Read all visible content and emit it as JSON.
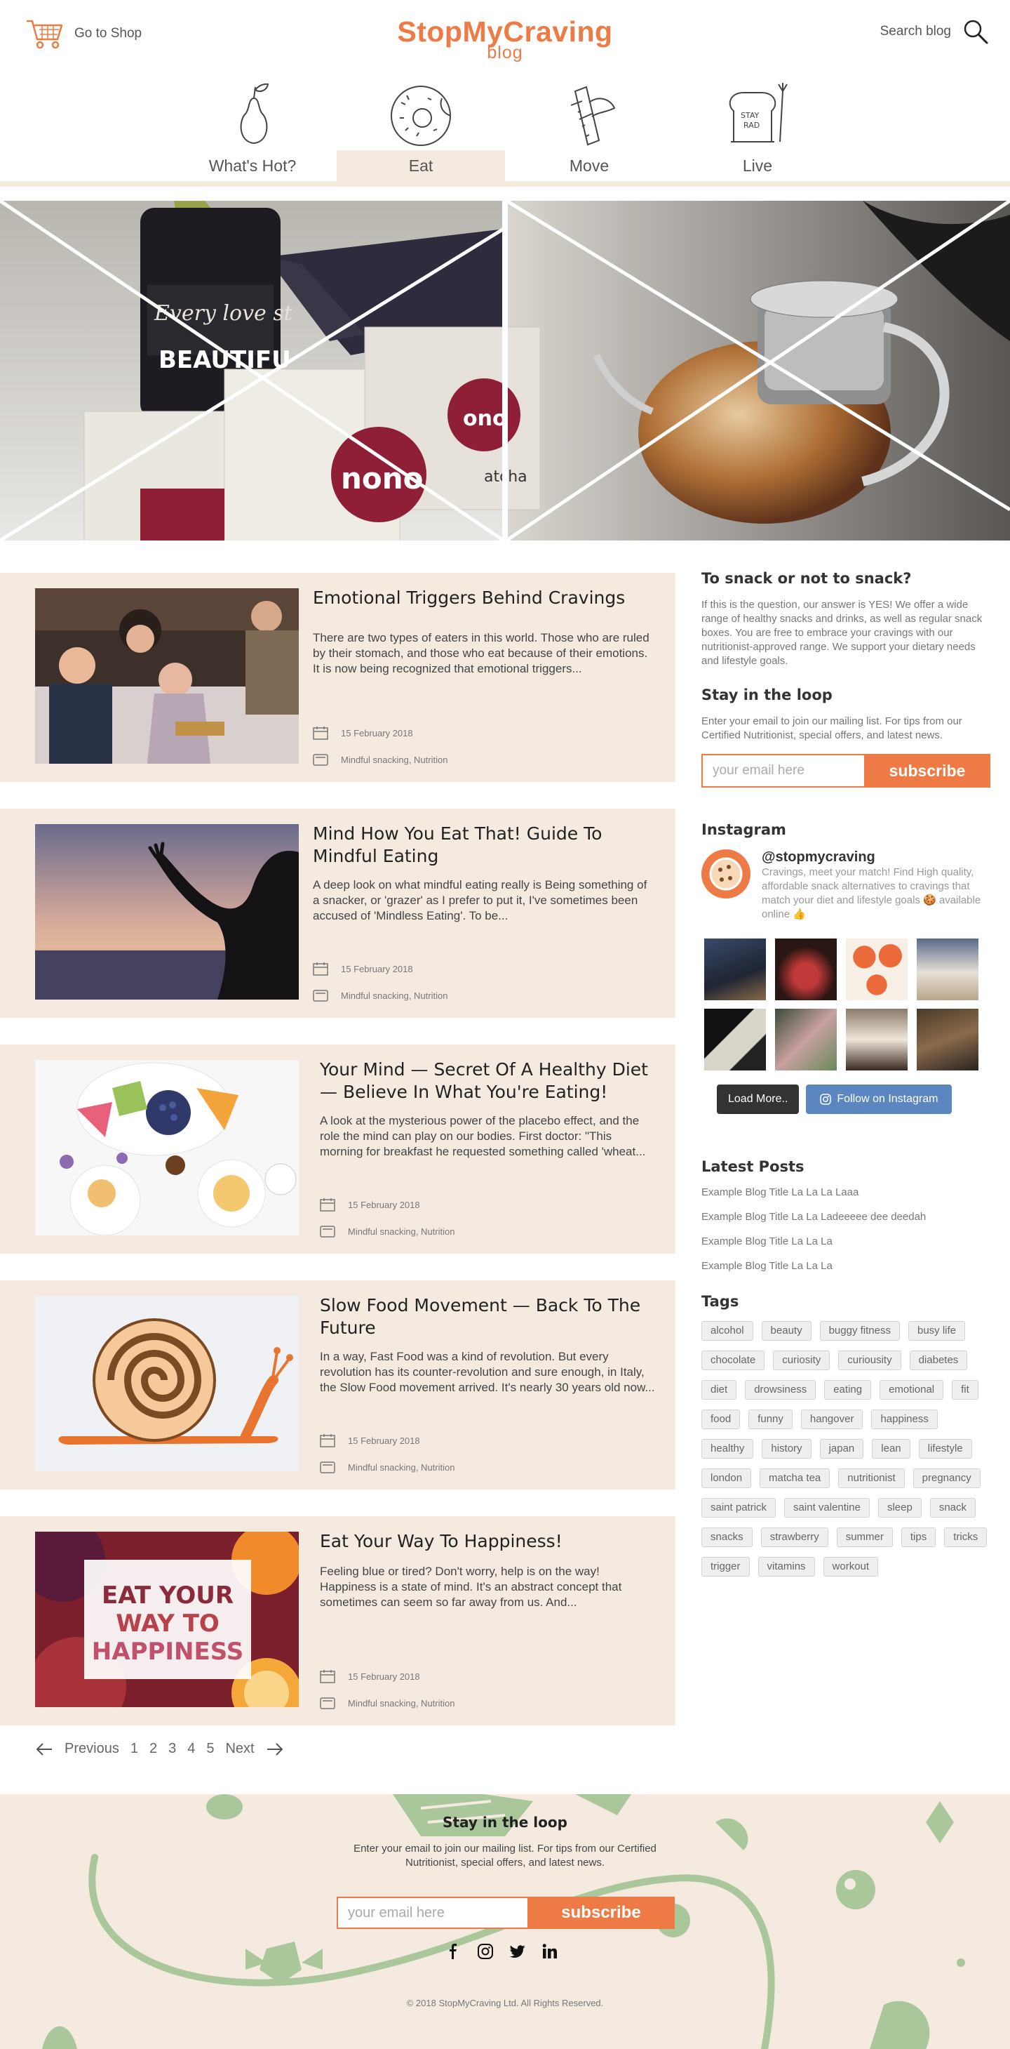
{
  "header": {
    "shop_label": "Go to Shop",
    "logo_main": "StopMyCraving",
    "logo_sub": "blog",
    "search_label": "Search blog"
  },
  "nav": {
    "items": [
      {
        "label": "What's Hot?",
        "icon": "pear-icon"
      },
      {
        "label": "Eat",
        "icon": "donut-icon",
        "active": true
      },
      {
        "label": "Move",
        "icon": "snack-bar-icon"
      },
      {
        "label": "Live",
        "icon": "toast-icon"
      }
    ]
  },
  "posts": [
    {
      "title": "Emotional Triggers Behind Cravings",
      "excerpt": "There are two types of eaters in this world. Those who are ruled by their stomach, and those who eat because of their emotions. It is now being recognized that emotional triggers...",
      "date": "15 February 2018",
      "categories": "Mindful snacking, Nutrition"
    },
    {
      "title": "Mind How You Eat That! Guide To Mindful Eating",
      "excerpt": "A deep look on what mindful eating really is   Being something of a snacker, or 'grazer' as I prefer to put it, I've sometimes been accused of 'Mindless Eating'. To be...",
      "date": "15 February 2018",
      "categories": "Mindful snacking, Nutrition"
    },
    {
      "title": "Your Mind — Secret Of A Healthy Diet — Believe In What You're Eating!",
      "excerpt": " A look at the mysterious power of the placebo effect, and the role the mind can play on our bodies.   First doctor: \"This morning for breakfast he requested something called 'wheat...",
      "date": "15 February 2018",
      "categories": "Mindful snacking, Nutrition"
    },
    {
      "title": "Slow Food Movement — Back To The Future",
      "excerpt": "In a way, Fast Food was a kind of revolution. But every revolution has its counter-revolution and sure enough, in Italy, the Slow Food movement arrived. It's nearly 30 years old now...",
      "date": "15 February 2018",
      "categories": "Mindful snacking, Nutrition"
    },
    {
      "title": "Eat Your Way To Happiness!",
      "excerpt": "Feeling blue or tired? Don't worry, help is on the way! Happiness is a state of mind. It's an abstract concept that sometimes can seem so far away from us. And...",
      "date": "15 February 2018",
      "categories": "Mindful snacking, Nutrition",
      "thumb_text": [
        "EAT YOUR",
        "WAY TO",
        "HAPPINESS"
      ]
    }
  ],
  "pager": {
    "prev": "Previous",
    "pages": [
      "1",
      "2",
      "3",
      "4",
      "5"
    ],
    "next": "Next"
  },
  "sidebar": {
    "snack_title": "To snack or not to snack?",
    "snack_text": "If this is the question, our answer is YES! We offer a wide range of healthy snacks and drinks, as well as regular snack boxes. You are free to embrace your cravings with our nutritionist-approved range. We support your dietary needs and lifestyle goals.",
    "loop_title": "Stay in the loop",
    "loop_text": "Enter your email to join our mailing list. For tips from our Certified Nutritionist, special offers, and latest news.",
    "email_placeholder": "your email here",
    "subscribe": "subscribe",
    "insta_title": "Instagram",
    "insta_handle": "@stopmycraving",
    "insta_bio": "Cravings, meet your match! Find High quality, affordable snack alternatives to cravings that match your diet and lifestyle goals 🍪 available online 👍",
    "load_more": "Load More..",
    "follow": "Follow on Instagram",
    "latest_title": "Latest Posts",
    "latest": [
      "Example Blog Title La La La Laaa",
      "Example Blog Title La La Ladeeeee dee deedah",
      "Example Blog Title La La La",
      "Example Blog Title La La La"
    ],
    "tags_title": "Tags",
    "tags": [
      "alcohol",
      "beauty",
      "buggy fitness",
      "busy life",
      "chocolate",
      "curiosity",
      "curiousity",
      "diabetes",
      "diet",
      "drowsiness",
      "eating",
      "emotional",
      "fit",
      "food",
      "funny",
      "hangover",
      "happiness",
      "healthy",
      "history",
      "japan",
      "lean",
      "lifestyle",
      "london",
      "matcha tea",
      "nutritionist",
      "pregnancy",
      "saint patrick",
      "saint valentine",
      "sleep",
      "snack",
      "snacks",
      "strawberry",
      "summer",
      "tips",
      "tricks",
      "trigger",
      "vitamins",
      "workout"
    ]
  },
  "footer": {
    "title": "Stay in the loop",
    "text": "Enter your email to join our mailing list. For tips from our Certified Nutritionist, special offers, and latest news.",
    "email_placeholder": "your email here",
    "subscribe": "subscribe",
    "copyright": "2018 StopMyCraving Ltd. All Rights Reserved."
  },
  "colors": {
    "accent": "#ee7b45",
    "panel": "#f4eae0",
    "footer_deco": "#a9c79b"
  }
}
